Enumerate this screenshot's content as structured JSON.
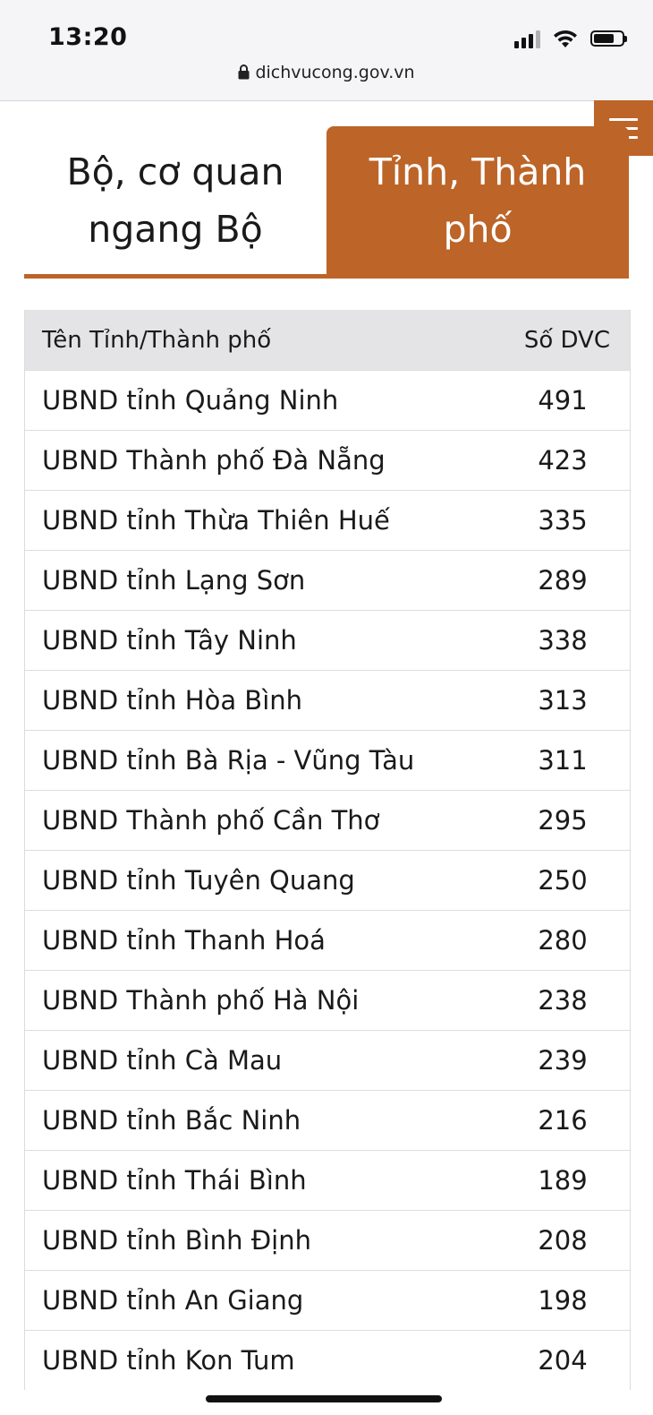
{
  "status": {
    "time": "13:20",
    "url": "dichvucong.gov.vn"
  },
  "icons": {
    "lock": "lock-icon",
    "signal": "cellular-signal-icon",
    "wifi": "wifi-icon",
    "battery": "battery-icon",
    "menu": "hamburger-menu-icon"
  },
  "colors": {
    "accent": "#bd6428",
    "header_bg": "#e4e4e6"
  },
  "tabs": {
    "ministry_line1": "Bộ, cơ quan",
    "ministry_line2": "ngang Bộ",
    "province_line1": "Tỉnh, Thành",
    "province_line2": "phố",
    "active": "province"
  },
  "table": {
    "header_name": "Tên Tỉnh/Thành phố",
    "header_count": "Số DVC",
    "rows": [
      {
        "name": "UBND tỉnh Quảng Ninh",
        "count": "491"
      },
      {
        "name": "UBND Thành phố Đà Nẵng",
        "count": "423"
      },
      {
        "name": "UBND tỉnh Thừa Thiên Huế",
        "count": "335"
      },
      {
        "name": "UBND tỉnh Lạng Sơn",
        "count": "289"
      },
      {
        "name": "UBND tỉnh Tây Ninh",
        "count": "338"
      },
      {
        "name": "UBND tỉnh Hòa Bình",
        "count": "313"
      },
      {
        "name": "UBND tỉnh Bà Rịa - Vũng Tàu",
        "count": "311"
      },
      {
        "name": "UBND Thành phố Cần Thơ",
        "count": "295"
      },
      {
        "name": "UBND tỉnh Tuyên Quang",
        "count": "250"
      },
      {
        "name": "UBND tỉnh Thanh Hoá",
        "count": "280"
      },
      {
        "name": "UBND Thành phố Hà Nội",
        "count": "238"
      },
      {
        "name": "UBND tỉnh Cà Mau",
        "count": "239"
      },
      {
        "name": "UBND tỉnh Bắc Ninh",
        "count": "216"
      },
      {
        "name": "UBND tỉnh Thái Bình",
        "count": "189"
      },
      {
        "name": "UBND tỉnh Bình Định",
        "count": "208"
      },
      {
        "name": "UBND tỉnh An Giang",
        "count": "198"
      },
      {
        "name": "UBND tỉnh Kon Tum",
        "count": "204"
      }
    ]
  }
}
